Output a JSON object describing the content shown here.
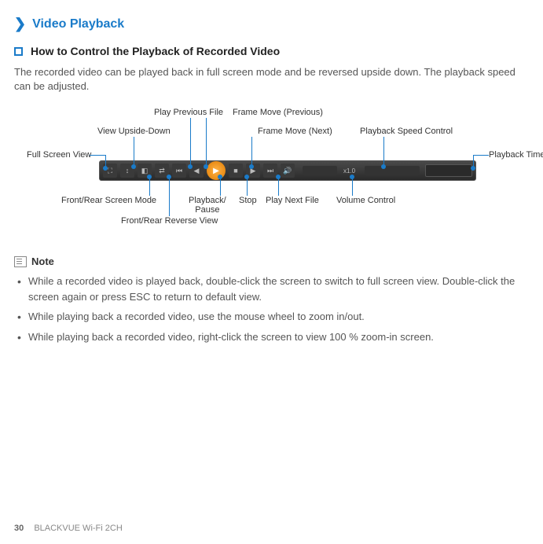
{
  "section": {
    "title": "Video Playback",
    "subtitle": "How to Control the Playback of Recorded Video",
    "intro": "The recorded video can be played back in full screen mode and be reversed upside down. The playback speed can be adjusted."
  },
  "labels": {
    "play_prev": "Play Previous File",
    "frame_prev": "Frame Move (Previous)",
    "view_upside": "View Upside-Down",
    "frame_next": "Frame Move (Next)",
    "speed_ctrl": "Playback Speed Control",
    "full_screen": "Full Screen View",
    "playback_time": "Playback Time",
    "front_rear_mode": "Front/Rear Screen Mode",
    "play_pause": "Playback/\nPause",
    "stop": "Stop",
    "play_next": "Play Next File",
    "volume": "Volume Control",
    "front_rear_rev": "Front/Rear Reverse View"
  },
  "note": {
    "label": "Note",
    "items": [
      "While a recorded video is played back, double-click the screen to switch to full screen view. Double-click the screen again or press ESC to return to default view.",
      "While playing back a recorded video, use the mouse wheel to zoom in/out.",
      "While playing back a recorded video, right-click the screen to view 100 % zoom-in screen."
    ]
  },
  "footer": {
    "page": "30",
    "model": "BLACKVUE Wi-Fi 2CH"
  }
}
